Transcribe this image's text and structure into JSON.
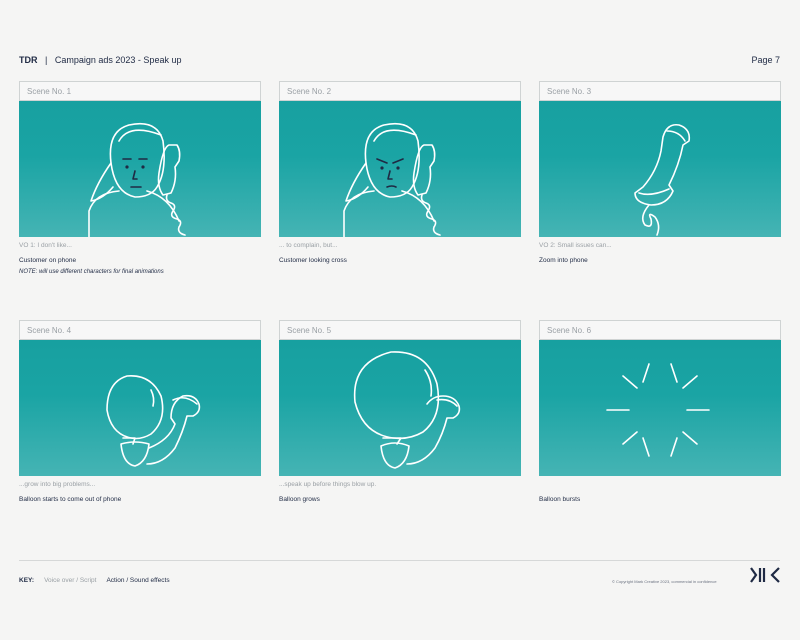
{
  "header": {
    "brand": "TDR",
    "separator": "|",
    "title": "Campaign ads 2023 - Speak up",
    "page": "Page 7"
  },
  "scenes": [
    {
      "label": "Scene No. 1",
      "vo": "VO 1: I don't like...",
      "action": "Customer on phone",
      "note": "NOTE: will use different characters for final animations",
      "illustration": "woman-on-phone"
    },
    {
      "label": "Scene No. 2",
      "vo": "... to complain, but...",
      "action": "Customer looking cross",
      "note": "",
      "illustration": "woman-cross-on-phone"
    },
    {
      "label": "Scene No. 3",
      "vo": "VO 2: Small issues can...",
      "action": "Zoom into phone",
      "note": "",
      "illustration": "phone-handset"
    },
    {
      "label": "Scene No. 4",
      "vo": "...grow into big problems...",
      "action": "Balloon starts to come out of phone",
      "note": "",
      "illustration": "balloon-small"
    },
    {
      "label": "Scene No. 5",
      "vo": "...speak up before things blow up.",
      "action": "Balloon grows",
      "note": "",
      "illustration": "balloon-large"
    },
    {
      "label": "Scene No. 6",
      "vo": "",
      "action": "Balloon bursts",
      "note": "",
      "illustration": "burst"
    }
  ],
  "key": {
    "title": "KEY:",
    "voice_over": "Voice over / Script",
    "action": "Action / Sound effects"
  },
  "footer": {
    "copyright": "© Copyright Mark Creative 2023, commercial in confidence"
  },
  "colors": {
    "teal": "#17a0a0",
    "navy": "#1f2a44",
    "muted": "#9aa0a5"
  }
}
